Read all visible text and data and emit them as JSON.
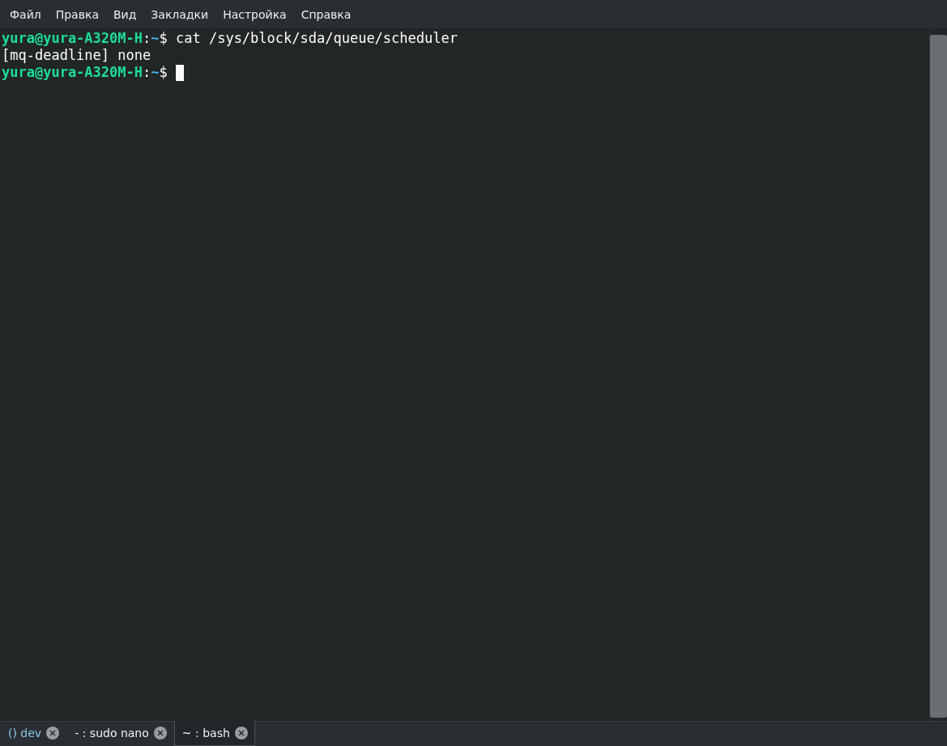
{
  "menu": [
    "Файл",
    "Правка",
    "Вид",
    "Закладки",
    "Настройка",
    "Справка"
  ],
  "terminal": {
    "lines": [
      {
        "kind": "prompt",
        "user_host": "yura@yura-A320M-H",
        "separator": ":",
        "path": "~",
        "symbol": "$",
        "command": "cat /sys/block/sda/queue/scheduler"
      },
      {
        "kind": "output",
        "text": "[mq-deadline] none"
      },
      {
        "kind": "prompt",
        "user_host": "yura@yura-A320M-H",
        "separator": ":",
        "path": "~",
        "symbol": "$",
        "cursor": true
      }
    ]
  },
  "tabs": [
    {
      "label": "() dev",
      "selected": false,
      "color": "#8ac6e8"
    },
    {
      "label": "- : sudo nano",
      "selected": false,
      "color": "#eff0f1"
    },
    {
      "label": "~ : bash",
      "selected": true,
      "color": "#eff0f1"
    }
  ]
}
